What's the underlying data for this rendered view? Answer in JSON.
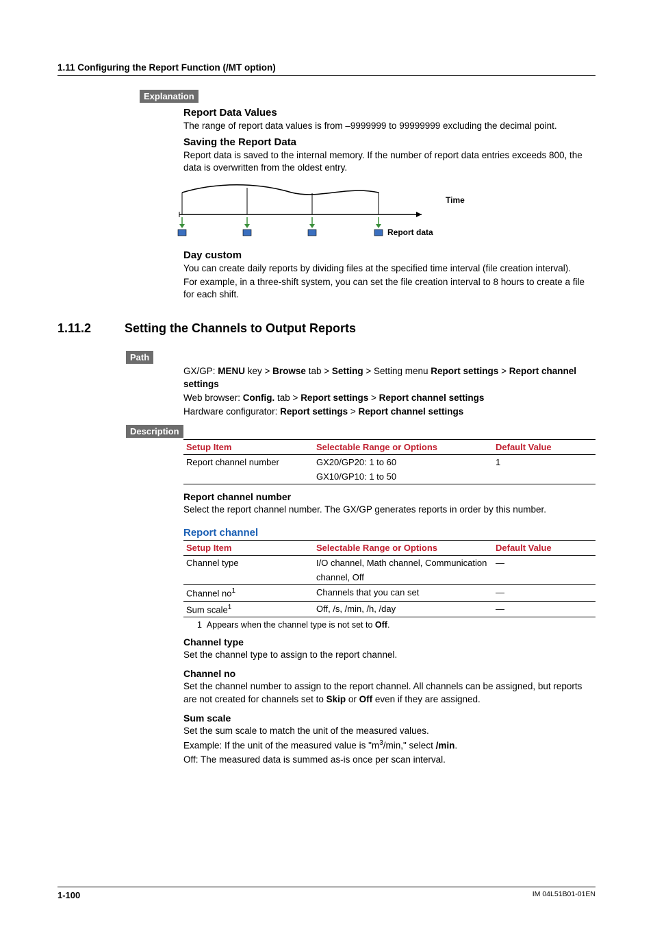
{
  "header": {
    "section_title": "1.11  Configuring the Report Function (/MT option)"
  },
  "explanation": {
    "badge": "Explanation",
    "rdv_title": "Report Data Values",
    "rdv_text": "The range of report data values is from –9999999 to 99999999 excluding the decimal point.",
    "save_title": "Saving the Report Data",
    "save_text": "Report data is saved to the internal memory. If the number of report data entries exceeds 800, the data is overwritten from the oldest entry.",
    "diagram_time_label": "Time",
    "diagram_report_label": "Report data",
    "daycustom_title": "Day custom",
    "daycustom_text1": "You can create daily reports by dividing files at the specified time interval (file creation interval).",
    "daycustom_text2": "For example, in a three-shift system, you can set the file creation interval to 8 hours to create a file for each shift."
  },
  "section112": {
    "number": "1.11.2",
    "title": "Setting the Channels to Output Reports"
  },
  "path": {
    "badge": "Path",
    "line1_pre": "GX/GP: ",
    "line1_b1": "MENU",
    "line1_mid1": " key > ",
    "line1_b2": "Browse",
    "line1_mid2": " tab > ",
    "line1_b3": "Setting",
    "line1_mid3": " > Setting menu ",
    "line1_b4": "Report settings",
    "line1_mid4": " > ",
    "line1_b5": "Report channel settings",
    "line2_pre": "Web browser: ",
    "line2_b1": "Config.",
    "line2_mid1": " tab > ",
    "line2_b2": "Report settings",
    "line2_mid2": " > ",
    "line2_b3": "Report channel settings",
    "line3_pre": "Hardware configurator: ",
    "line3_b1": "Report settings",
    "line3_mid": " > ",
    "line3_b2": "Report channel settings"
  },
  "description": {
    "badge": "Description",
    "headers": {
      "c1": "Setup Item",
      "c2": "Selectable Range or Options",
      "c3": "Default Value"
    },
    "table1": {
      "r1c1": "Report channel number",
      "r1c2a": "GX20/GP20: 1 to 60",
      "r1c2b": "GX10/GP10: 1 to 50",
      "r1c3": "1"
    },
    "rcn_title": "Report channel number",
    "rcn_text": "Select the report channel number. The GX/GP generates reports in order by this number.",
    "rc_heading": "Report channel",
    "table2": {
      "r1c1": "Channel type",
      "r1c2a": "I/O channel, Math channel, Communication",
      "r1c2b": "channel, Off",
      "r1c3": "—",
      "r2c1_base": "Channel no",
      "r2_sup": "1",
      "r2c2": "Channels that you can set",
      "r2c3": "—",
      "r3c1_base": "Sum scale",
      "r3_sup": "1",
      "r3c2": "Off, /s, /min, /h, /day",
      "r3c3": "—"
    },
    "footnote_num": "1",
    "footnote_pre": "Appears when the channel type is not set to ",
    "footnote_bold": "Off",
    "footnote_post": ".",
    "ct_title": "Channel type",
    "ct_text": "Set the channel type to assign to the report channel.",
    "cn_title": "Channel no",
    "cn_text_pre": "Set the channel number to assign to the report channel. All channels can be assigned, but reports are not created for channels set to ",
    "cn_b1": "Skip",
    "cn_mid": " or ",
    "cn_b2": "Off",
    "cn_post": " even if they are assigned.",
    "ss_title": "Sum scale",
    "ss_text1": "Set the sum scale to match the unit of the measured values.",
    "ss_text2_pre": "Example: If the unit of the measured value is \"m",
    "ss_text2_sup": "3",
    "ss_text2_mid": "/min,\" select ",
    "ss_text2_b": "/min",
    "ss_text2_post": ".",
    "ss_text3": "Off: The measured data is summed as-is once per scan interval."
  },
  "footer": {
    "page": "1-100",
    "docid": "IM 04L51B01-01EN"
  }
}
